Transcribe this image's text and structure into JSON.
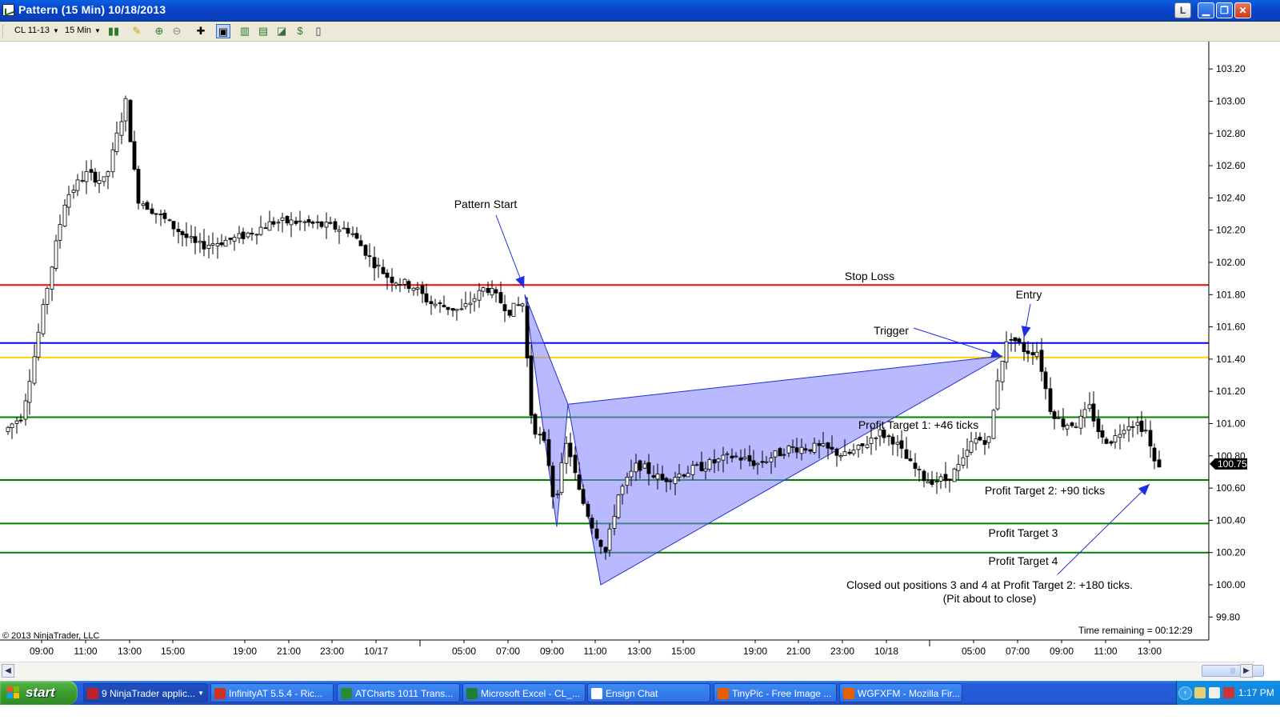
{
  "window": {
    "title": "Pattern (15 Min)  10/18/2013",
    "buttons": {
      "l": "L",
      "minimize": "▁",
      "restore": "❐",
      "close": "✕"
    }
  },
  "toolbar": {
    "instrument": "CL 11-13",
    "interval": "15 Min",
    "icons": [
      "bar-style-icon",
      "drawing-pencil-icon",
      "zoom-in-icon",
      "zoom-out-icon",
      "crosshair-icon",
      "chart-properties-icon",
      "data-box-icon",
      "strategy-icon",
      "indicators-icon",
      "order-icon",
      "properties-icon"
    ]
  },
  "chart_data": {
    "type": "candlestick",
    "instrument": "CL 11-13",
    "interval": "15 Min",
    "price_labels": [
      "103.20",
      "103.00",
      "102.80",
      "102.60",
      "102.40",
      "102.20",
      "102.00",
      "101.80",
      "101.60",
      "101.40",
      "101.20",
      "101.00",
      "100.80",
      "100.60",
      "100.40",
      "100.20",
      "100.00",
      "99.80"
    ],
    "ylim": [
      99.7,
      103.35
    ],
    "current_price": "100.75",
    "time_labels": [
      "09:00",
      "11:00",
      "13:00",
      "15:00",
      "19:00",
      "21:00",
      "23:00",
      "10/17",
      "05:00",
      "07:00",
      "09:00",
      "11:00",
      "13:00",
      "15:00",
      "19:00",
      "21:00",
      "23:00",
      "10/18",
      "05:00",
      "07:00",
      "09:00",
      "11:00",
      "13:00"
    ],
    "horizontal_lines": [
      {
        "price": 101.86,
        "color": "#ff0000",
        "label": "Stop Loss"
      },
      {
        "price": 101.5,
        "color": "#0000ff",
        "label": ""
      },
      {
        "price": 101.41,
        "color": "#ffd700",
        "label": ""
      },
      {
        "price": 101.04,
        "color": "#008000",
        "label": "Profit Target 1:  +46 ticks"
      },
      {
        "price": 100.65,
        "color": "#008000",
        "label": "Profit Target 2:  +90 ticks"
      },
      {
        "price": 100.38,
        "color": "#008000",
        "label": "Profit Target 3"
      },
      {
        "price": 100.2,
        "color": "#008000",
        "label": "Profit Target 4"
      }
    ],
    "annotations": [
      "Pattern Start",
      "Trigger",
      "Entry",
      "Closed out positions 3 and 4 at Profit Target 2:  +180 ticks.",
      "(Pit about to close)"
    ],
    "pattern_color": "#8080ff",
    "copyright": "© 2013 NinjaTrader, LLC",
    "time_remaining": "Time remaining = 00:12:29"
  },
  "taskbar": {
    "start": "start",
    "tasks": [
      {
        "label": "9 NinjaTrader applic...",
        "color": "#c0202a"
      },
      {
        "label": "InfinityAT 5.5.4 - Ric...",
        "color": "#cc3322"
      },
      {
        "label": "ATCharts 1011 Trans...",
        "color": "#2a8a3a"
      },
      {
        "label": "Microsoft Excel - CL_...",
        "color": "#1e7e34"
      },
      {
        "label": "Ensign Chat",
        "color": "#ffffff"
      },
      {
        "label": "TinyPic - Free Image ...",
        "color": "#e66000"
      },
      {
        "label": "WGFXFM - Mozilla Fir...",
        "color": "#e66000"
      }
    ],
    "clock": "1:17 PM"
  }
}
